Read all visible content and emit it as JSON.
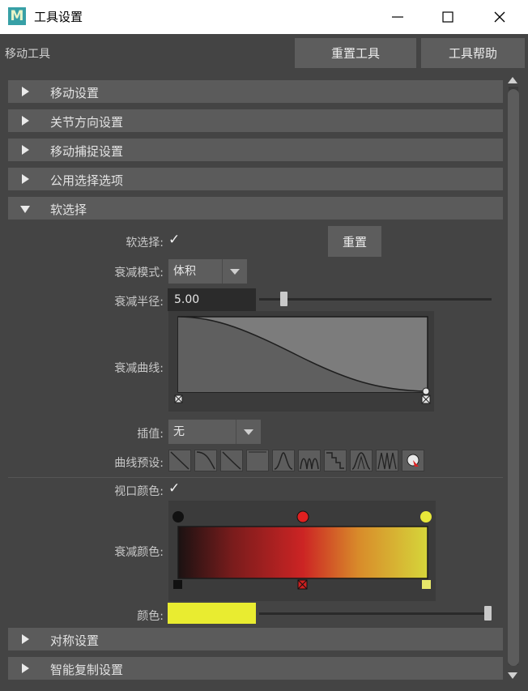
{
  "window": {
    "app_icon_letter": "M",
    "title": "工具设置",
    "minimize_icon": "minimize-icon",
    "maximize_icon": "maximize-icon",
    "close_icon": "close-icon"
  },
  "toolbar": {
    "tool_name": "移动工具",
    "reset_tool": "重置工具",
    "tool_help": "工具帮助"
  },
  "sections": [
    {
      "label": "移动设置",
      "expanded": false
    },
    {
      "label": "关节方向设置",
      "expanded": false
    },
    {
      "label": "移动捕捉设置",
      "expanded": false
    },
    {
      "label": "公用选择选项",
      "expanded": false
    },
    {
      "label": "软选择",
      "expanded": true
    },
    {
      "label": "对称设置",
      "expanded": false
    },
    {
      "label": "智能复制设置",
      "expanded": false
    }
  ],
  "soft_select": {
    "toggle_label": "软选择:",
    "toggle_checked": true,
    "check_glyph": "✓",
    "reset": "重置",
    "falloff_mode_label": "衰减模式:",
    "falloff_mode_value": "体积",
    "falloff_radius_label": "衰减半径:",
    "falloff_radius_value": "5.00",
    "falloff_radius_slider_fraction": 0.04,
    "falloff_curve_label": "衰减曲线:",
    "interpolation_label": "插值:",
    "interpolation_value": "无",
    "curve_presets_label": "曲线预设:",
    "viewport_color_label": "视口颜色:",
    "viewport_color_checked": true,
    "falloff_color_label": "衰减颜色:",
    "color_label": "颜色:",
    "color_swatch": "#e9ec30",
    "color_slider_fraction": 1.0,
    "gradient_stops": [
      "#1a1a1a",
      "#cc2222",
      "#d8d83a"
    ]
  },
  "colors": {
    "title_bg": "#ffffff",
    "panel_bg": "#444444",
    "section_bg": "#5b5b5b",
    "button_bg": "#5d5d5d",
    "field_bg": "#2b2b2b",
    "app_icon_bg": "#37a0a6"
  }
}
